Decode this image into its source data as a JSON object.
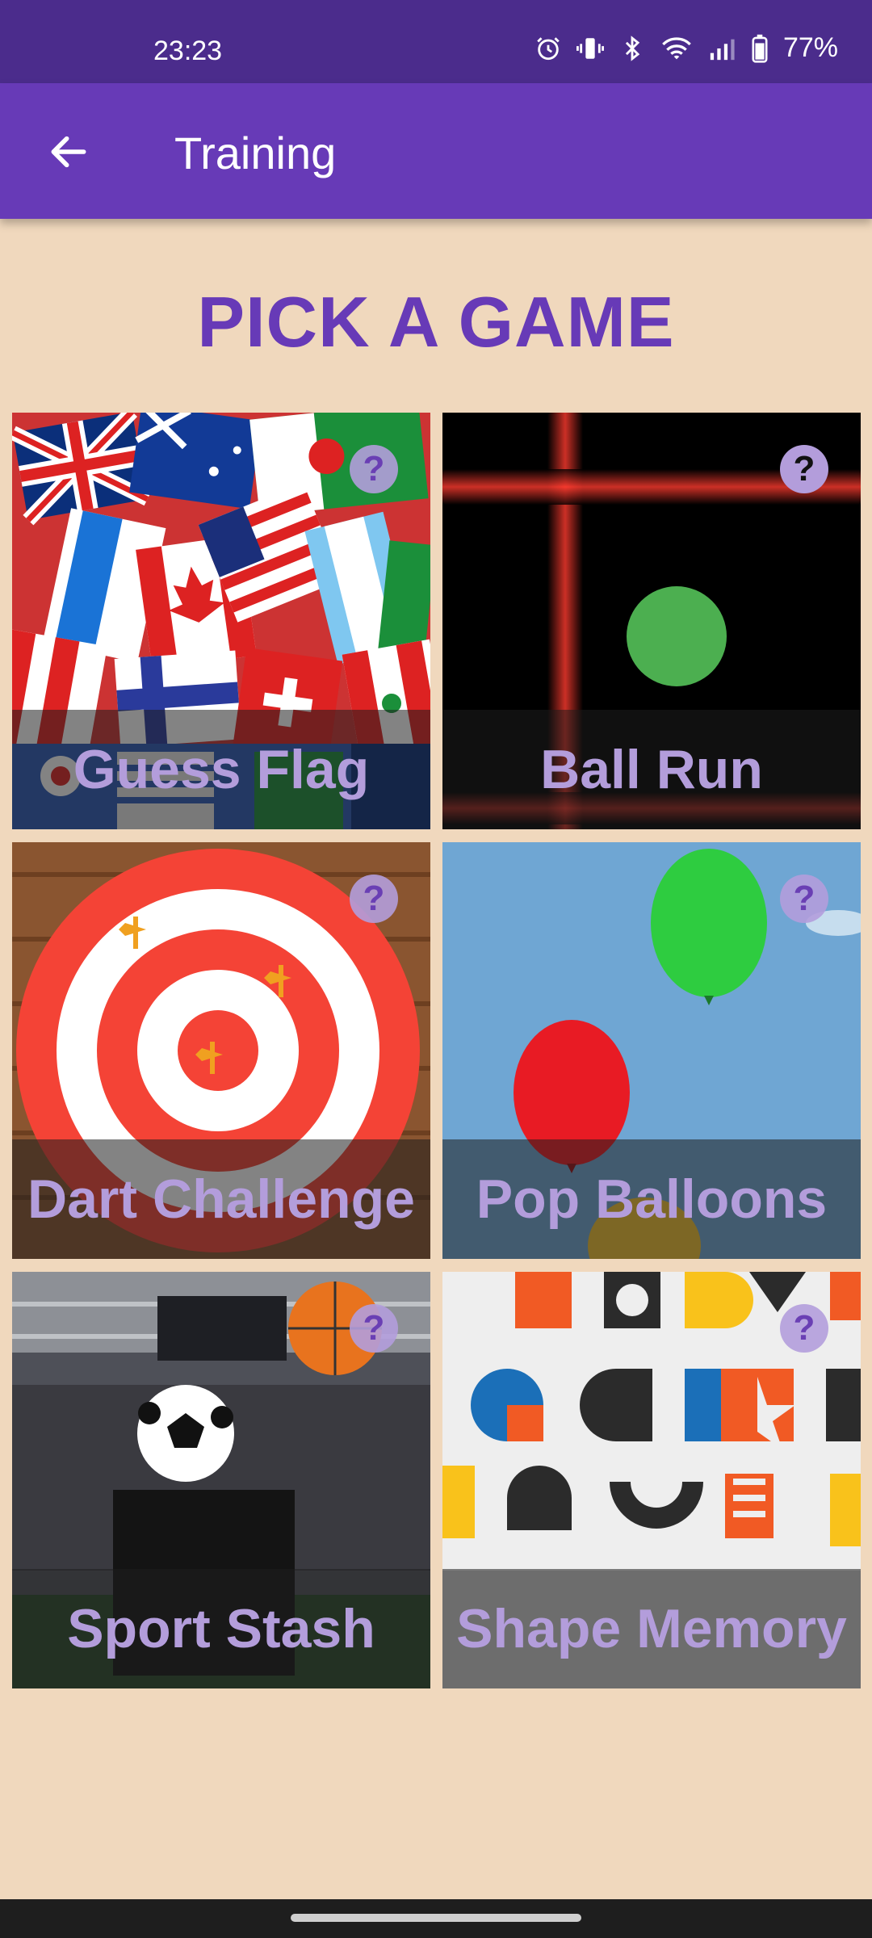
{
  "status": {
    "time": "23:23",
    "battery": "77%"
  },
  "app_bar": {
    "title": "Training"
  },
  "heading": "PICK A GAME",
  "tiles": [
    {
      "label": "Guess Flag",
      "help": "?"
    },
    {
      "label": "Ball Run",
      "help": "?"
    },
    {
      "label": "Dart Challenge",
      "help": "?"
    },
    {
      "label": "Pop Balloons",
      "help": "?"
    },
    {
      "label": "Sport Stash",
      "help": "?"
    },
    {
      "label": "Shape Memory",
      "help": "?"
    }
  ],
  "colors": {
    "primary": "#673ab7",
    "status_bar": "#4b2c8c",
    "background": "#f0d8bd",
    "label": "#b39ddb"
  }
}
